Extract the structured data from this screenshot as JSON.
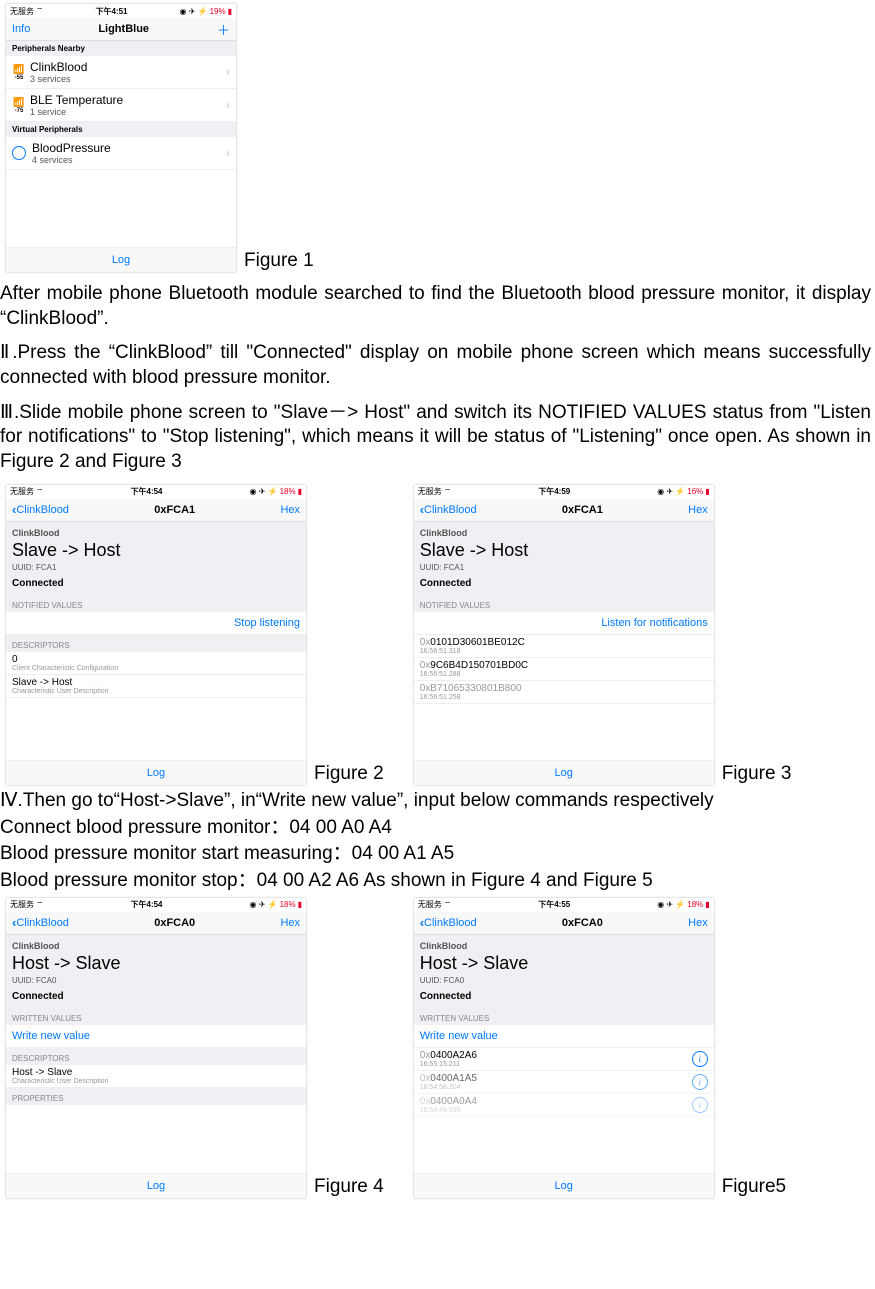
{
  "fig1": {
    "status": {
      "carrier": "无服务",
      "wifi": "⌔",
      "time": "下午4:51",
      "icons": "◉ ✈ ⚡",
      "battery": "19%"
    },
    "nav": {
      "left": "Info",
      "title": "LightBlue",
      "right": "＋"
    },
    "sec1": "Peripherals Nearby",
    "p1": {
      "rssi": "-55",
      "name": "ClinkBlood",
      "sub": "3 services"
    },
    "p2": {
      "rssi": "-75",
      "name": "BLE Temperature",
      "sub": "1 service"
    },
    "sec2": "Virtual Peripherals",
    "p3": {
      "name": "BloodPressure",
      "sub": "4 services"
    },
    "log": "Log",
    "label": "Figure 1"
  },
  "para1": "After mobile phone Bluetooth module searched to find the Bluetooth blood pressure monitor, it display “ClinkBlood”.",
  "para2": "Ⅱ.Press the  “ClinkBlood” till \"Connected\" display on mobile phone screen which means successfully connected with blood pressure monitor.",
  "para3": "Ⅲ.Slide mobile phone screen to \"Slave－> Host\" and switch its NOTIFIED VALUES status from \"Listen for notifications\" to \"Stop listening\", which means it will be status of \"Listening\" once open. As shown in Figure 2 and Figure 3",
  "fig2": {
    "status": {
      "carrier": "无服务",
      "wifi": "⌔",
      "time": "下午4:54",
      "icons": "◉ ✈ ⚡",
      "battery": "18%"
    },
    "nav": {
      "back": "ClinkBlood",
      "title": "0xFCA1",
      "right": "Hex"
    },
    "dev": "ClinkBlood",
    "main": "Slave -> Host",
    "uuid": "UUID: FCA1",
    "conn": "Connected",
    "sec": "NOTIFIED VALUES",
    "link": "Stop listening",
    "sec2": "DESCRIPTORS",
    "d1": {
      "t": "0",
      "s": "Client Characteristic Configuration"
    },
    "d2": {
      "t": "Slave -> Host",
      "s": "Characteristic User Description"
    },
    "log": "Log",
    "label": "Figure 2"
  },
  "fig3": {
    "status": {
      "carrier": "无服务",
      "wifi": "⌔",
      "time": "下午4:59",
      "icons": "◉ ✈ ⚡",
      "battery": "16%"
    },
    "nav": {
      "back": "ClinkBlood",
      "title": "0xFCA1",
      "right": "Hex"
    },
    "dev": "ClinkBlood",
    "main": "Slave -> Host",
    "uuid": "UUID: FCA1",
    "conn": "Connected",
    "sec": "NOTIFIED VALUES",
    "link": "Listen for notifications",
    "v1": {
      "h": "0101D30601BE012C",
      "t": "16:56:51.318"
    },
    "v2": {
      "h": "9C6B4D150701BD0C",
      "t": "16:56:51.288"
    },
    "v3": {
      "h": "B71065330801B800",
      "t": "16:56:51.258"
    },
    "log": "Log",
    "label": "Figure 3"
  },
  "para4": "Ⅳ.Then go to“Host->Slave”, in“Write new value”, input below commands respectively",
  "para5": "Connect blood pressure monitor：04 00 A0 A4",
  "para6": "Blood pressure monitor start measuring：04 00 A1 A5",
  "para7": "Blood pressure monitor stop：04 00 A2 A6        As shown in Figure 4 and Figure 5",
  "fig4": {
    "status": {
      "carrier": "无服务",
      "wifi": "⌔",
      "time": "下午4:54",
      "icons": "◉ ✈ ⚡",
      "battery": "18%"
    },
    "nav": {
      "back": "ClinkBlood",
      "title": "0xFCA0",
      "right": "Hex"
    },
    "dev": "ClinkBlood",
    "main": "Host -> Slave",
    "uuid": "UUID: FCA0",
    "conn": "Connected",
    "sec": "WRITTEN VALUES",
    "link": "Write new value",
    "sec2": "DESCRIPTORS",
    "d1": {
      "t": "Host -> Slave",
      "s": "Characteristic User Description"
    },
    "sec3": "PROPERTIES",
    "log": "Log",
    "label": "Figure 4"
  },
  "fig5": {
    "status": {
      "carrier": "无服务",
      "wifi": "⌔",
      "time": "下午4:55",
      "icons": "◉ ✈ ⚡",
      "battery": "18%"
    },
    "nav": {
      "back": "ClinkBlood",
      "title": "0xFCA0",
      "right": "Hex"
    },
    "dev": "ClinkBlood",
    "main": "Host -> Slave",
    "uuid": "UUID: FCA0",
    "conn": "Connected",
    "sec": "WRITTEN VALUES",
    "link": "Write new value",
    "v1": {
      "h": "0400A2A6",
      "t": "16:55:15.211"
    },
    "v2": {
      "h": "0400A1A5",
      "t": "16:54:58.204"
    },
    "v3": {
      "h": "0400A0A4",
      "t": "16:54:49.595"
    },
    "log": "Log",
    "label": "Figure5"
  }
}
